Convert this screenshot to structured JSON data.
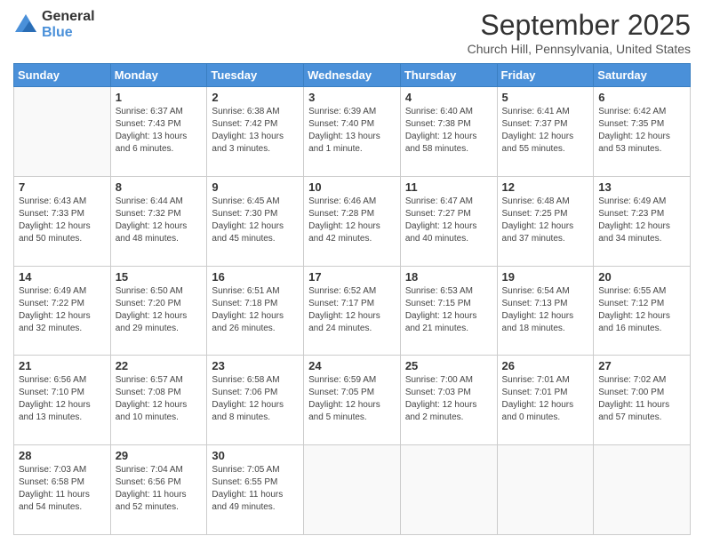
{
  "logo": {
    "general": "General",
    "blue": "Blue"
  },
  "header": {
    "month": "September 2025",
    "location": "Church Hill, Pennsylvania, United States"
  },
  "weekdays": [
    "Sunday",
    "Monday",
    "Tuesday",
    "Wednesday",
    "Thursday",
    "Friday",
    "Saturday"
  ],
  "weeks": [
    [
      {
        "day": null
      },
      {
        "day": "1",
        "sunrise": "Sunrise: 6:37 AM",
        "sunset": "Sunset: 7:43 PM",
        "daylight": "Daylight: 13 hours and 6 minutes."
      },
      {
        "day": "2",
        "sunrise": "Sunrise: 6:38 AM",
        "sunset": "Sunset: 7:42 PM",
        "daylight": "Daylight: 13 hours and 3 minutes."
      },
      {
        "day": "3",
        "sunrise": "Sunrise: 6:39 AM",
        "sunset": "Sunset: 7:40 PM",
        "daylight": "Daylight: 13 hours and 1 minute."
      },
      {
        "day": "4",
        "sunrise": "Sunrise: 6:40 AM",
        "sunset": "Sunset: 7:38 PM",
        "daylight": "Daylight: 12 hours and 58 minutes."
      },
      {
        "day": "5",
        "sunrise": "Sunrise: 6:41 AM",
        "sunset": "Sunset: 7:37 PM",
        "daylight": "Daylight: 12 hours and 55 minutes."
      },
      {
        "day": "6",
        "sunrise": "Sunrise: 6:42 AM",
        "sunset": "Sunset: 7:35 PM",
        "daylight": "Daylight: 12 hours and 53 minutes."
      }
    ],
    [
      {
        "day": "7",
        "sunrise": "Sunrise: 6:43 AM",
        "sunset": "Sunset: 7:33 PM",
        "daylight": "Daylight: 12 hours and 50 minutes."
      },
      {
        "day": "8",
        "sunrise": "Sunrise: 6:44 AM",
        "sunset": "Sunset: 7:32 PM",
        "daylight": "Daylight: 12 hours and 48 minutes."
      },
      {
        "day": "9",
        "sunrise": "Sunrise: 6:45 AM",
        "sunset": "Sunset: 7:30 PM",
        "daylight": "Daylight: 12 hours and 45 minutes."
      },
      {
        "day": "10",
        "sunrise": "Sunrise: 6:46 AM",
        "sunset": "Sunset: 7:28 PM",
        "daylight": "Daylight: 12 hours and 42 minutes."
      },
      {
        "day": "11",
        "sunrise": "Sunrise: 6:47 AM",
        "sunset": "Sunset: 7:27 PM",
        "daylight": "Daylight: 12 hours and 40 minutes."
      },
      {
        "day": "12",
        "sunrise": "Sunrise: 6:48 AM",
        "sunset": "Sunset: 7:25 PM",
        "daylight": "Daylight: 12 hours and 37 minutes."
      },
      {
        "day": "13",
        "sunrise": "Sunrise: 6:49 AM",
        "sunset": "Sunset: 7:23 PM",
        "daylight": "Daylight: 12 hours and 34 minutes."
      }
    ],
    [
      {
        "day": "14",
        "sunrise": "Sunrise: 6:49 AM",
        "sunset": "Sunset: 7:22 PM",
        "daylight": "Daylight: 12 hours and 32 minutes."
      },
      {
        "day": "15",
        "sunrise": "Sunrise: 6:50 AM",
        "sunset": "Sunset: 7:20 PM",
        "daylight": "Daylight: 12 hours and 29 minutes."
      },
      {
        "day": "16",
        "sunrise": "Sunrise: 6:51 AM",
        "sunset": "Sunset: 7:18 PM",
        "daylight": "Daylight: 12 hours and 26 minutes."
      },
      {
        "day": "17",
        "sunrise": "Sunrise: 6:52 AM",
        "sunset": "Sunset: 7:17 PM",
        "daylight": "Daylight: 12 hours and 24 minutes."
      },
      {
        "day": "18",
        "sunrise": "Sunrise: 6:53 AM",
        "sunset": "Sunset: 7:15 PM",
        "daylight": "Daylight: 12 hours and 21 minutes."
      },
      {
        "day": "19",
        "sunrise": "Sunrise: 6:54 AM",
        "sunset": "Sunset: 7:13 PM",
        "daylight": "Daylight: 12 hours and 18 minutes."
      },
      {
        "day": "20",
        "sunrise": "Sunrise: 6:55 AM",
        "sunset": "Sunset: 7:12 PM",
        "daylight": "Daylight: 12 hours and 16 minutes."
      }
    ],
    [
      {
        "day": "21",
        "sunrise": "Sunrise: 6:56 AM",
        "sunset": "Sunset: 7:10 PM",
        "daylight": "Daylight: 12 hours and 13 minutes."
      },
      {
        "day": "22",
        "sunrise": "Sunrise: 6:57 AM",
        "sunset": "Sunset: 7:08 PM",
        "daylight": "Daylight: 12 hours and 10 minutes."
      },
      {
        "day": "23",
        "sunrise": "Sunrise: 6:58 AM",
        "sunset": "Sunset: 7:06 PM",
        "daylight": "Daylight: 12 hours and 8 minutes."
      },
      {
        "day": "24",
        "sunrise": "Sunrise: 6:59 AM",
        "sunset": "Sunset: 7:05 PM",
        "daylight": "Daylight: 12 hours and 5 minutes."
      },
      {
        "day": "25",
        "sunrise": "Sunrise: 7:00 AM",
        "sunset": "Sunset: 7:03 PM",
        "daylight": "Daylight: 12 hours and 2 minutes."
      },
      {
        "day": "26",
        "sunrise": "Sunrise: 7:01 AM",
        "sunset": "Sunset: 7:01 PM",
        "daylight": "Daylight: 12 hours and 0 minutes."
      },
      {
        "day": "27",
        "sunrise": "Sunrise: 7:02 AM",
        "sunset": "Sunset: 7:00 PM",
        "daylight": "Daylight: 11 hours and 57 minutes."
      }
    ],
    [
      {
        "day": "28",
        "sunrise": "Sunrise: 7:03 AM",
        "sunset": "Sunset: 6:58 PM",
        "daylight": "Daylight: 11 hours and 54 minutes."
      },
      {
        "day": "29",
        "sunrise": "Sunrise: 7:04 AM",
        "sunset": "Sunset: 6:56 PM",
        "daylight": "Daylight: 11 hours and 52 minutes."
      },
      {
        "day": "30",
        "sunrise": "Sunrise: 7:05 AM",
        "sunset": "Sunset: 6:55 PM",
        "daylight": "Daylight: 11 hours and 49 minutes."
      },
      {
        "day": null
      },
      {
        "day": null
      },
      {
        "day": null
      },
      {
        "day": null
      }
    ]
  ]
}
